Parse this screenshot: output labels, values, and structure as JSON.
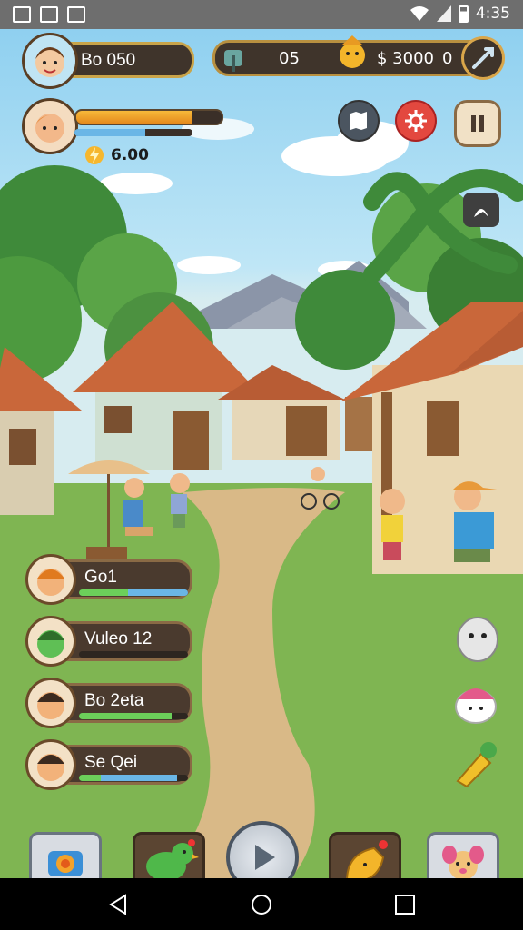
{
  "status_bar": {
    "time": "4:35"
  },
  "hud": {
    "player_name": "Bo 050",
    "gem_count": "05",
    "coin_amount": "$ 3000",
    "coin_suffix": "0",
    "energy_value": "6.00",
    "energy_fill": 0.6,
    "xp_fill": 0.8
  },
  "roster": [
    {
      "name": "Go1",
      "bar_green": 0.45,
      "bar_blue": 0.55,
      "avatar_color": "#f2b27a",
      "hair": "#e07a1f"
    },
    {
      "name": "Vuleo 12",
      "bar_green": 0.0,
      "bar_blue": 0.0,
      "avatar_color": "#5fbf55",
      "hair": "#2f6e2a"
    },
    {
      "name": "Bo 2eta",
      "bar_green": 0.85,
      "bar_blue": 0.0,
      "avatar_color": "#f2b27a",
      "hair": "#3b2a1f"
    },
    {
      "name": "Se Qei",
      "bar_green": 0.2,
      "bar_blue": 0.7,
      "avatar_color": "#f2b27a",
      "hair": "#3b2a1f"
    }
  ],
  "colors": {
    "accent_gold": "#c9a44a",
    "panel_dark": "#3f342b",
    "grass": "#7fb552",
    "path": "#d9b987",
    "roof": "#c9673a"
  },
  "icons": {
    "top_right": [
      "map-icon",
      "settings-icon",
      "pause-icon"
    ],
    "side": "rock-creature-icon",
    "toolbar": [
      "camera-icon",
      "green-bird-icon",
      "play-icon",
      "gold-item-icon",
      "puppy-icon"
    ]
  }
}
